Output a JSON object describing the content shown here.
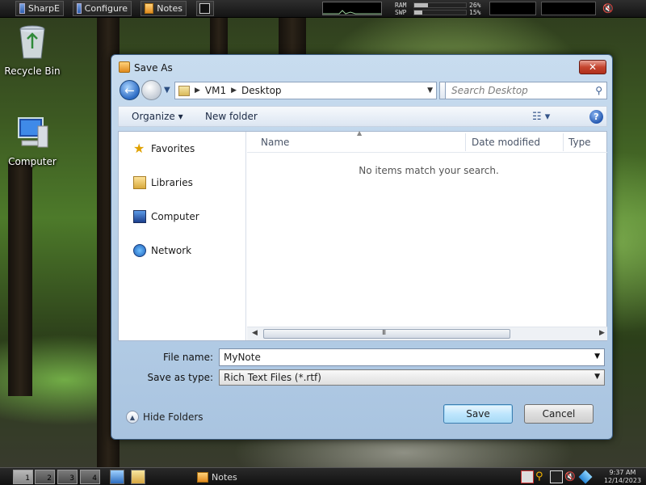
{
  "topbar": {
    "buttons": [
      "SharpE",
      "Configure",
      "Notes"
    ],
    "terminal_icon": "terminal-icon",
    "ram_label": "RAM",
    "swp_label": "SWP",
    "ram_value": "26%",
    "swp_value": "15%",
    "ram_fraction": 0.26,
    "swp_fraction": 0.15
  },
  "desktop": {
    "icons": [
      {
        "label": "Recycle Bin",
        "icon": "recycle-bin-icon"
      },
      {
        "label": "Computer",
        "icon": "computer-icon"
      }
    ]
  },
  "dialog": {
    "title": "Save As",
    "close_glyph": "✕",
    "address": {
      "parts": [
        "VM1",
        "Desktop"
      ]
    },
    "search_placeholder": "Search Desktop",
    "toolbar": {
      "organize": "Organize ▾",
      "new_folder": "New folder"
    },
    "nav": {
      "items": [
        {
          "label": "Favorites",
          "icon": "star-icon"
        },
        {
          "label": "Libraries",
          "icon": "library-icon"
        },
        {
          "label": "Computer",
          "icon": "computer-icon"
        },
        {
          "label": "Network",
          "icon": "network-icon"
        }
      ]
    },
    "columns": [
      "Name",
      "Date modified",
      "Type"
    ],
    "empty_message": "No items match your search.",
    "form": {
      "file_name_label": "File name:",
      "file_name_value": "MyNote",
      "save_type_label": "Save as type:",
      "save_type_value": "Rich Text Files (*.rtf)"
    },
    "hide_folders": "Hide Folders",
    "save_button": "Save",
    "cancel_button": "Cancel"
  },
  "taskbar": {
    "workspaces": [
      "1",
      "2",
      "3",
      "4"
    ],
    "task": "Notes",
    "clock_time": "9:37 AM",
    "clock_date": "12/14/2023"
  },
  "colors": {
    "dialog_frame": "#a9c4e0",
    "primary_button": "#bee6fd",
    "close_button": "#c5452f"
  }
}
